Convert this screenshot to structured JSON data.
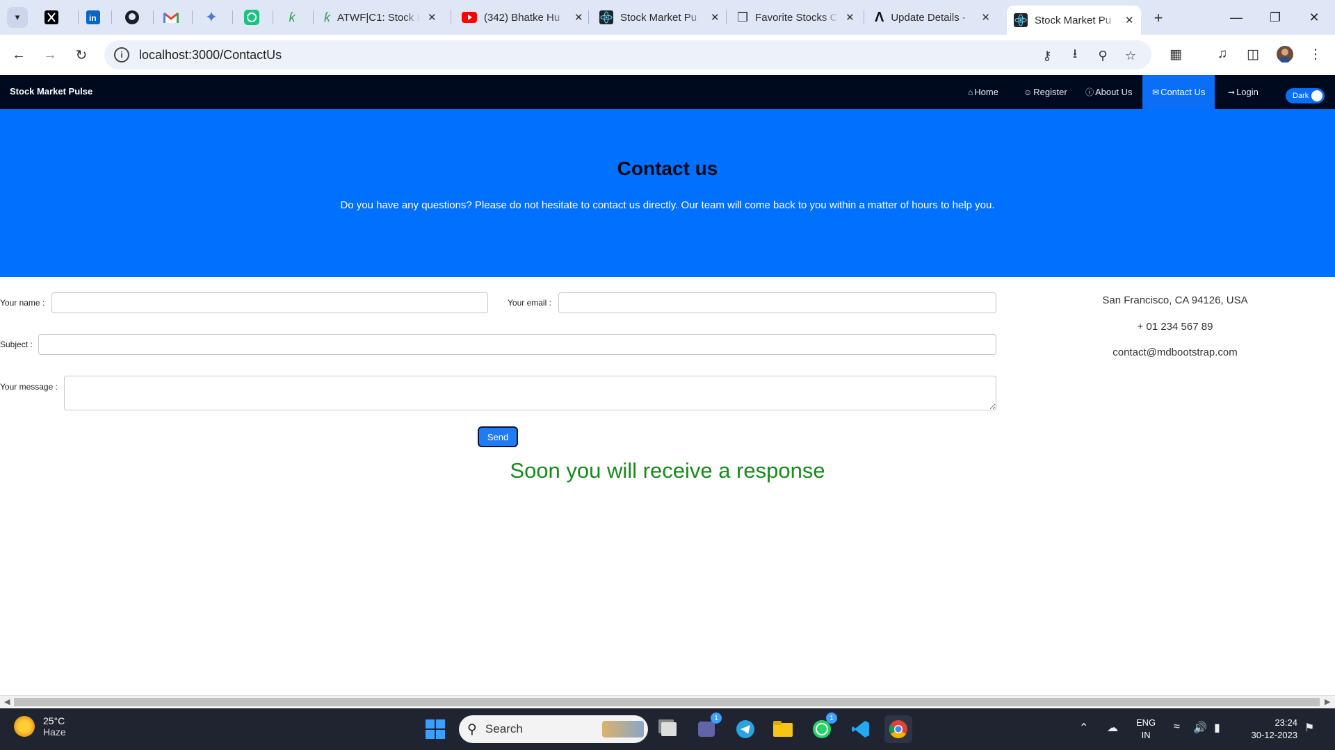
{
  "browser": {
    "tabs": [
      {
        "title": "ATWF|C1: Stock I"
      },
      {
        "title": "(342) Bhatke Hu"
      },
      {
        "title": "Stock Market Pu"
      },
      {
        "title": "Favorite Stocks C"
      },
      {
        "title": "Update Details -"
      },
      {
        "title": "Stock Market Pu"
      }
    ],
    "url": "localhost:3000/ContactUs"
  },
  "navbar": {
    "brand": "Stock Market Pulse",
    "links": [
      {
        "label": "Home"
      },
      {
        "label": "Register"
      },
      {
        "label": "About Us"
      },
      {
        "label": "Contact Us"
      },
      {
        "label": "Login"
      }
    ],
    "toggle_label": "Dark"
  },
  "hero": {
    "title": "Contact us",
    "subtitle": "Do you have any questions? Please do not hesitate to contact us directly. Our team will come back to you within a matter of hours to help you."
  },
  "form": {
    "name_label": "Your name :",
    "email_label": "Your email :",
    "subject_label": "Subject :",
    "message_label": "Your message :",
    "send_label": "Send",
    "response": "Soon you will receive a response"
  },
  "contact_info": {
    "address": "San Francisco, CA 94126, USA",
    "phone": "+ 01 234 567 89",
    "email": "contact@mdbootstrap.com"
  },
  "taskbar": {
    "temperature": "25°C",
    "weather": "Haze",
    "search_label": "Search",
    "lang1": "ENG",
    "lang2": "IN",
    "time": "23:24",
    "date": "30-12-2023",
    "badge_teams": "1",
    "badge_whatsapp": "1"
  },
  "colors": {
    "hero_bg": "#0070ff",
    "navbar_bg": "#000a1f",
    "response_text": "#178a1c"
  }
}
